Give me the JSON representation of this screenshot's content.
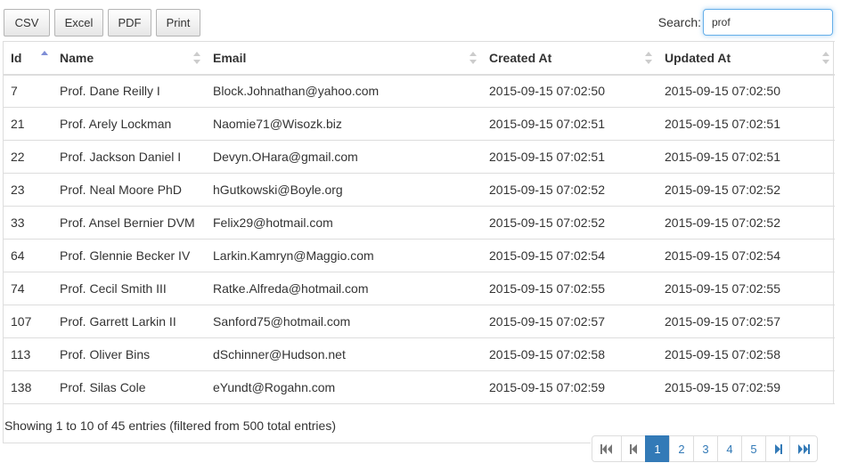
{
  "toolbar": {
    "buttons": [
      "CSV",
      "Excel",
      "PDF",
      "Print"
    ]
  },
  "search": {
    "label": "Search:",
    "value": "prof"
  },
  "table": {
    "columns": [
      "Id",
      "Name",
      "Email",
      "Created At",
      "Updated At"
    ],
    "rows": [
      [
        "7",
        "Prof. Dane Reilly I",
        "Block.Johnathan@yahoo.com",
        "2015-09-15 07:02:50",
        "2015-09-15 07:02:50"
      ],
      [
        "21",
        "Prof. Arely Lockman",
        "Naomie71@Wisozk.biz",
        "2015-09-15 07:02:51",
        "2015-09-15 07:02:51"
      ],
      [
        "22",
        "Prof. Jackson Daniel I",
        "Devyn.OHara@gmail.com",
        "2015-09-15 07:02:51",
        "2015-09-15 07:02:51"
      ],
      [
        "23",
        "Prof. Neal Moore PhD",
        "hGutkowski@Boyle.org",
        "2015-09-15 07:02:52",
        "2015-09-15 07:02:52"
      ],
      [
        "33",
        "Prof. Ansel Bernier DVM",
        "Felix29@hotmail.com",
        "2015-09-15 07:02:52",
        "2015-09-15 07:02:52"
      ],
      [
        "64",
        "Prof. Glennie Becker IV",
        "Larkin.Kamryn@Maggio.com",
        "2015-09-15 07:02:54",
        "2015-09-15 07:02:54"
      ],
      [
        "74",
        "Prof. Cecil Smith III",
        "Ratke.Alfreda@hotmail.com",
        "2015-09-15 07:02:55",
        "2015-09-15 07:02:55"
      ],
      [
        "107",
        "Prof. Garrett Larkin II",
        "Sanford75@hotmail.com",
        "2015-09-15 07:02:57",
        "2015-09-15 07:02:57"
      ],
      [
        "113",
        "Prof. Oliver Bins",
        "dSchinner@Hudson.net",
        "2015-09-15 07:02:58",
        "2015-09-15 07:02:58"
      ],
      [
        "138",
        "Prof. Silas Cole",
        "eYundt@Rogahn.com",
        "2015-09-15 07:02:59",
        "2015-09-15 07:02:59"
      ]
    ]
  },
  "info": "Showing 1 to 10 of 45 entries (filtered from 500 total entries)",
  "pagination": {
    "icons": [
      "first-page-icon",
      "previous-page-icon",
      "next-page-icon",
      "last-page-icon"
    ],
    "pages": [
      "1",
      "2",
      "3",
      "4",
      "5"
    ],
    "active": "1"
  },
  "colors": {
    "accent": "#337ab7",
    "sort_active": "#7f8ed6"
  }
}
